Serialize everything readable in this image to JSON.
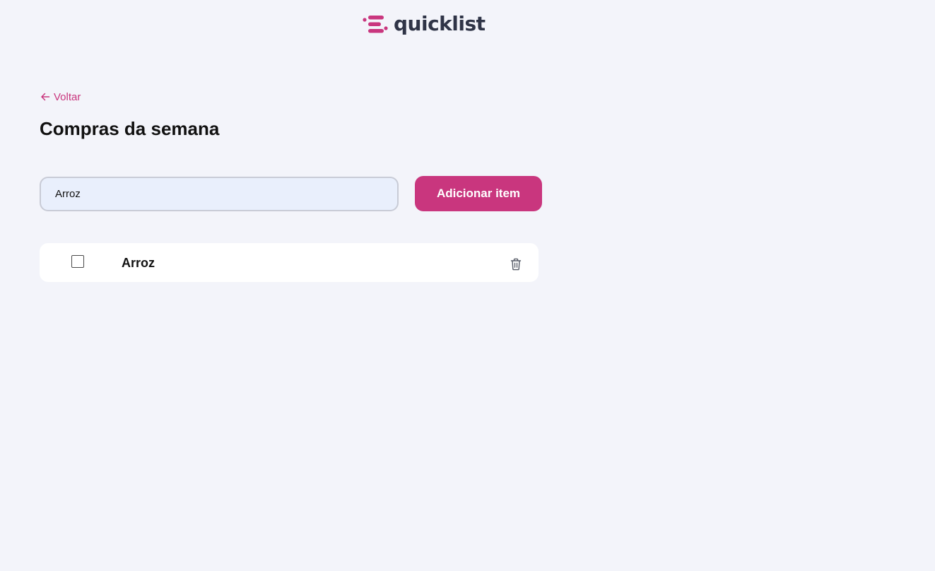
{
  "header": {
    "logo_text": "quicklist",
    "brand_color": "#c9367e",
    "logo_text_color": "#2f3447"
  },
  "nav": {
    "back_label": "Voltar",
    "back_icon": "arrow-left-icon"
  },
  "page": {
    "title": "Compras da semana"
  },
  "form": {
    "input_value": "Arroz",
    "add_button_label": "Adicionar item"
  },
  "list": {
    "items": [
      {
        "name": "Arroz",
        "checked": false,
        "delete_icon": "trash-icon"
      }
    ]
  }
}
